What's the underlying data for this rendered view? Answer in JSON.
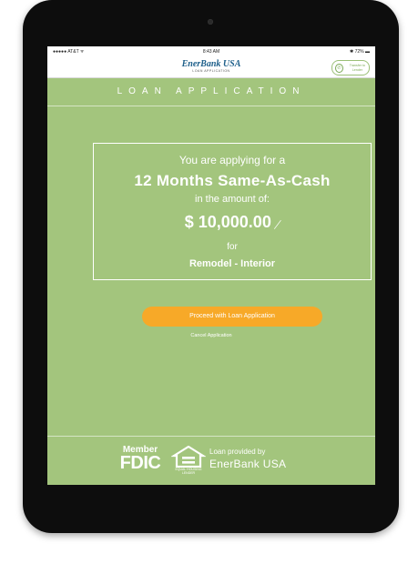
{
  "status_bar": {
    "carrier": "●●●●● AT&T ᯤ",
    "time": "8:43 AM",
    "battery": "✱ 72% ▬"
  },
  "app_bar": {
    "logo_text": "EnerBank USA",
    "logo_subtitle": "LOAN APPLICATION",
    "transfer_text": "Transfer to Lender"
  },
  "page": {
    "section_title": "LOAN APPLICATION"
  },
  "application": {
    "intro": "You are applying for a",
    "plan": "12 Months Same-As-Cash",
    "amount_intro": "in the amount of:",
    "amount": "$ 10,000.00",
    "for_label": "for",
    "purpose": "Remodel - Interior"
  },
  "actions": {
    "proceed_label": "Proceed with Loan Application",
    "cancel_label": "Cancel Application"
  },
  "footer": {
    "fdic_member": "Member",
    "fdic_name": "FDIC",
    "ehl_label": "EQUAL HOUSING LENDER",
    "loan_provided_by": "Loan provided by",
    "lender_name": "EnerBank USA"
  },
  "colors": {
    "screen_background": "#a3c57d",
    "accent_button": "#f7a928",
    "device": "#0d0d0d"
  },
  "icons": [
    "phone-icon",
    "edit-pencil-icon",
    "equal-housing-lender-icon",
    "bluetooth-icon",
    "battery-icon",
    "wifi-icon"
  ]
}
